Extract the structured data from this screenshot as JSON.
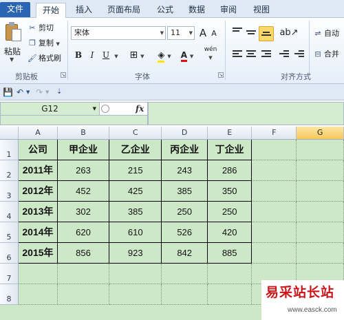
{
  "tabs": [
    "文件",
    "开始",
    "插入",
    "页面布局",
    "公式",
    "数据",
    "审阅",
    "视图"
  ],
  "clipboard": {
    "paste": "粘贴",
    "cut": "剪切",
    "copy": "复制",
    "format_painter": "格式刷",
    "group_label": "剪贴板"
  },
  "font": {
    "name": "宋体",
    "size": "11",
    "grow": "A",
    "shrink": "A",
    "bold": "B",
    "italic": "I",
    "underline": "U",
    "color_letter": "A",
    "phonetic": "wén",
    "group_label": "字体"
  },
  "alignment": {
    "wrap": "自动",
    "merge": "合并",
    "group_label": "对齐方式"
  },
  "formula_bar": {
    "name_box": "G12",
    "fx": "fx"
  },
  "columns": [
    "A",
    "B",
    "C",
    "D",
    "E",
    "F",
    "G"
  ],
  "rows": [
    "1",
    "2",
    "3",
    "4",
    "5",
    "6",
    "7",
    "8"
  ],
  "table": {
    "header": [
      "公司",
      "甲企业",
      "乙企业",
      "丙企业",
      "丁企业"
    ],
    "data": [
      [
        "2011年",
        "263",
        "215",
        "243",
        "286"
      ],
      [
        "2012年",
        "452",
        "425",
        "385",
        "350"
      ],
      [
        "2013年",
        "302",
        "385",
        "250",
        "250"
      ],
      [
        "2014年",
        "620",
        "610",
        "526",
        "420"
      ],
      [
        "2015年",
        "856",
        "923",
        "842",
        "885"
      ]
    ]
  },
  "watermark": {
    "text": "易采站长站",
    "url": "www.easck.com"
  },
  "colors": {
    "sheet_background": "#cde8c7",
    "selected_header": "#f6c65b",
    "file_tab": "#2a64b3",
    "watermark": "#c8161d"
  }
}
